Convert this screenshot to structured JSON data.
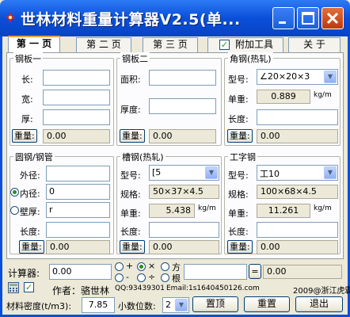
{
  "window": {
    "title": "世林材料重量计算器V2.5(单...",
    "buttons": {
      "minimize": "_",
      "maximize": "□",
      "close": "✕"
    }
  },
  "tabs": [
    {
      "label": "第 一 页",
      "active": true
    },
    {
      "label": "第 二 页",
      "active": false
    },
    {
      "label": "第 三 页",
      "active": false
    }
  ],
  "extra_tools": {
    "label": "附加工具",
    "checked": true
  },
  "about_label": "关  于",
  "steel_plate_1": {
    "title": "钢板一",
    "length_label": "长:",
    "width_label": "宽:",
    "thick_label": "厚:",
    "length_value": "",
    "width_value": "",
    "thick_value": "",
    "weight_label": "重量:",
    "weight_value": "0.00"
  },
  "steel_plate_2": {
    "title": "钢板二",
    "area_label": "面积:",
    "thick_label": "厚度:",
    "area_value": "",
    "thick_value": "",
    "weight_label": "重量:",
    "weight_value": "0.00"
  },
  "angle_steel": {
    "title": "角钢(热轧)",
    "model_label": "型号:",
    "model_value": "∠20×20×3",
    "unit_weight_label": "单重:",
    "unit_weight_value": "0.889",
    "unit": "kg/m",
    "length_label": "长度:",
    "length_value": "",
    "weight_label": "重量:",
    "weight_value": "0.00"
  },
  "round_steel": {
    "title": "圆钢/钢管",
    "outer_label": "外径:",
    "inner_label": "内径:",
    "wall_label": "壁厚:",
    "length_label": "长度:",
    "outer_value": "",
    "inner_value": "0",
    "wall_value": "r",
    "length_value": "",
    "inner_selected": true,
    "weight_label": "重量:",
    "weight_value": "0.00"
  },
  "channel_steel": {
    "title": "槽钢(热轧)",
    "model_label": "型号:",
    "model_value": "[5",
    "spec_label": "规格:",
    "spec_value": "50×37×4.5",
    "unit_weight_label": "单重:",
    "unit_weight_value": "5.438",
    "unit": "kg/m",
    "length_label": "长度:",
    "length_value": "",
    "weight_label": "重量:",
    "weight_value": "0.00"
  },
  "i_beam": {
    "title": "工字钢",
    "model_label": "型号:",
    "model_value": "工10",
    "spec_label": "规格:",
    "spec_value": "100×68×4.5",
    "unit_weight_label": "单重:",
    "unit_weight_value": "11.261",
    "unit": "kg/m",
    "length_label": "长度:",
    "length_value": "",
    "weight_label": "重量:",
    "weight_value": "0.00"
  },
  "calculator": {
    "label": "计算器:",
    "value": "0.00",
    "ops": [
      "+",
      "×",
      "方",
      "-",
      "÷",
      "根"
    ],
    "selected_op": "×",
    "operand_value": "",
    "equals_label": "=",
    "result_value": "0.00"
  },
  "footer": {
    "author": "作者：骆世林",
    "qq": "QQ:93439301",
    "email": "Email:1s1640450126.com",
    "copyright": "2009@浙江虎霸",
    "density_label": "材料密度(t/m3):",
    "density_value": "7.85",
    "decimals_label": "小数位数:",
    "decimals_value": "2",
    "topmost_label": "置顶",
    "reset_label": "重置",
    "exit_label": "退出"
  }
}
